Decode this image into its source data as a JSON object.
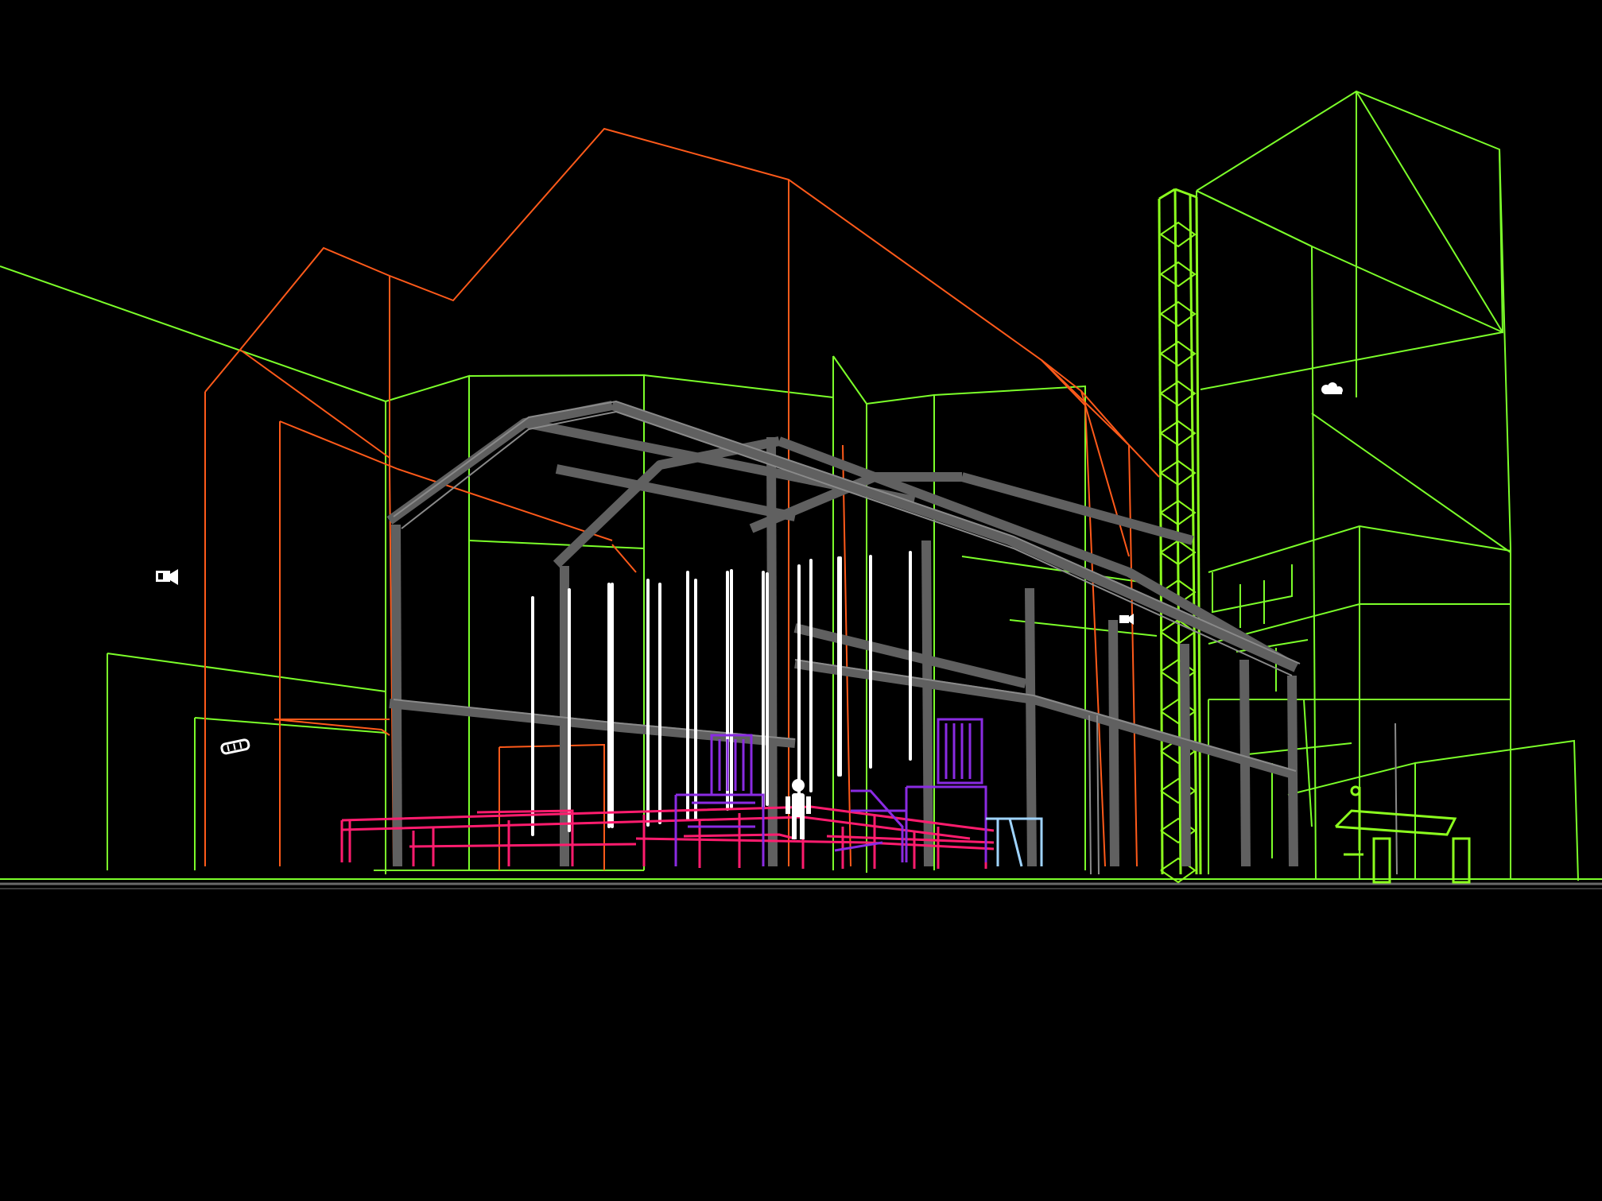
{
  "viewport": {
    "background": "#000000",
    "mode": "wireframe-3d"
  },
  "colors": {
    "building_outline": "#7cff2a",
    "tower_scaffold": "#8cff1e",
    "roof_outline": "#ff5a1a",
    "truss": "#6a6a6a",
    "hanging_lights": "#ffffff",
    "stage_platforms": "#ff1c6e",
    "stage_props": "#8a2be2",
    "light_blue_prop": "#9fd4ff",
    "ground_line": "#8a8a8a"
  },
  "icons": {
    "camera": "camera-icon",
    "light": "light-icon",
    "cloud": "cloud-icon",
    "small_camera": "small-camera-icon",
    "figure": "human-figure-icon"
  }
}
